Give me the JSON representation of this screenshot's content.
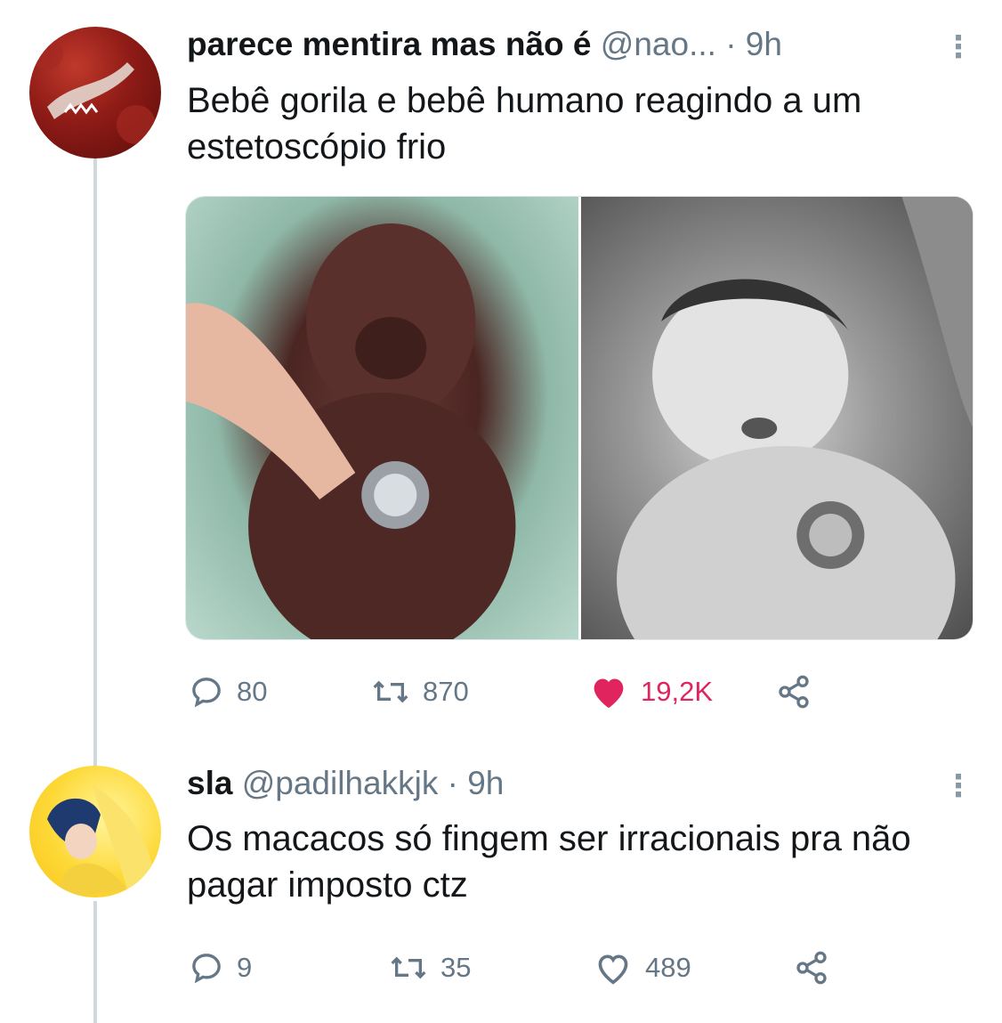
{
  "tweet1": {
    "author_name": "parece mentira mas não é",
    "author_handle": "@nao...",
    "time": "· 9h",
    "text": "Bebê gorila e bebê humano reagindo a um estetoscópio frio",
    "more_icon": "⋮",
    "stats": {
      "replies": "80",
      "retweets": "870",
      "likes": "19,2K"
    },
    "liked": true,
    "like_color": "#e0245e"
  },
  "tweet2": {
    "author_name": "sla",
    "author_handle": "@padilhakkjk",
    "time": "· 9h",
    "text": "Os macacos só fingem ser irracionais pra não pagar imposto ctz",
    "more_icon": "⋮",
    "stats": {
      "replies": "9",
      "retweets": "35",
      "likes": "489"
    },
    "liked": false
  }
}
